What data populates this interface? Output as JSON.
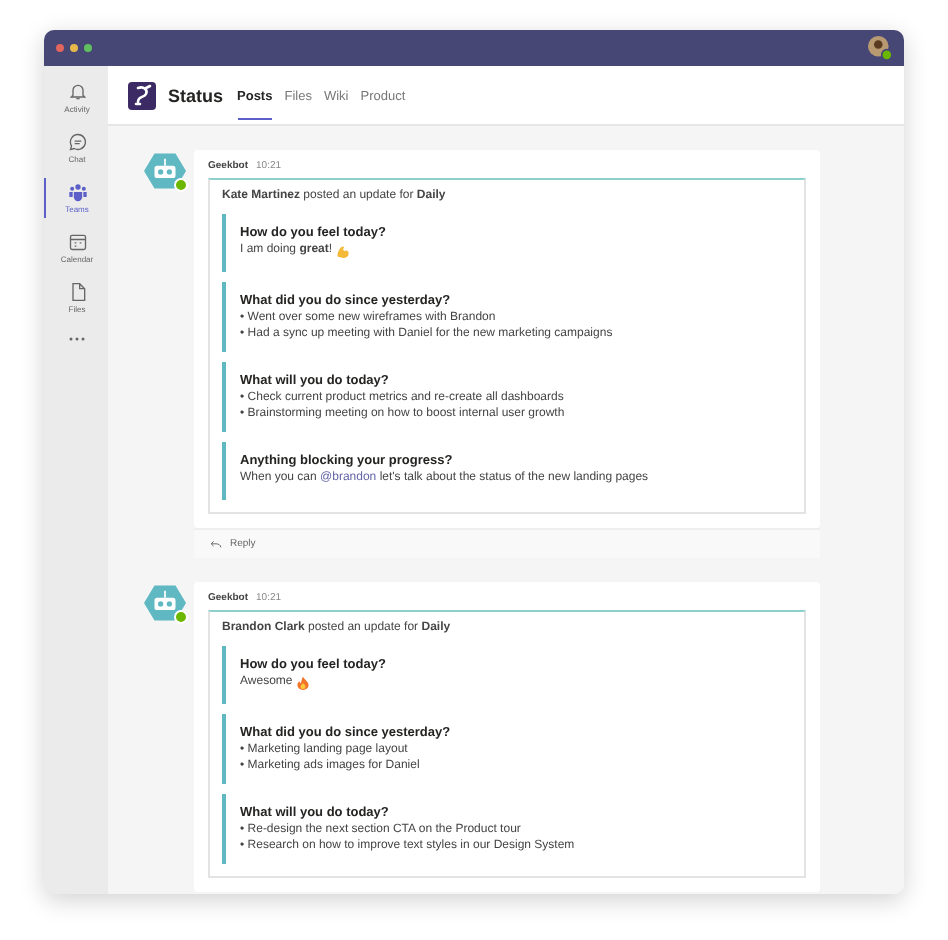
{
  "sidebar": {
    "items": [
      {
        "label": "Activity",
        "selected": false
      },
      {
        "label": "Chat",
        "selected": false
      },
      {
        "label": "Teams",
        "selected": true
      },
      {
        "label": "Calendar",
        "selected": false
      },
      {
        "label": "Files",
        "selected": false
      }
    ]
  },
  "header": {
    "title": "Status",
    "tabs": [
      {
        "label": "Posts",
        "selected": true
      },
      {
        "label": "Files",
        "selected": false
      },
      {
        "label": "Wiki",
        "selected": false
      },
      {
        "label": "Product",
        "selected": false
      }
    ]
  },
  "messages": [
    {
      "author": "Geekbot",
      "time": "10:21",
      "online": true,
      "intro": "**Kate Martinez** posted an update for **Daily**",
      "reply": "Reply",
      "sections": [
        {
          "question": "How do you feel today?",
          "lines": [
            {
              "text": "I am doing **great**!"
            }
          ]
        },
        {
          "question": "What did you do since yesterday?",
          "lines": [
            {
              "text": "• Went over some new wireframes with Brandon"
            },
            {
              "text": "• Had a sync up meeting with Daniel for the new marketing campaigns"
            }
          ]
        },
        {
          "question": "What will you do today?",
          "lines": [
            {
              "text": "• Check current product metrics and re-create all dashboards"
            },
            {
              "text": "• Brainstorming meeting on how to boost internal user growth"
            }
          ]
        },
        {
          "question": "Anything blocking your progress?",
          "lines": [
            {
              "text": "When you can ",
              "mention": "@brandon",
              "after": " let's talk about the status of the new landing pages"
            }
          ]
        }
      ]
    },
    {
      "author": "Geekbot",
      "time": "10:21",
      "online": true,
      "intro": "**Brandon Clark** posted an update for **Daily**",
      "sections": [
        {
          "question": "How do you feel today?",
          "lines": [
            {
              "text": "Awesome"
            }
          ]
        },
        {
          "question": "What did you do since yesterday?",
          "lines": [
            {
              "text": "• Marketing landing page layout"
            },
            {
              "text": "• Marketing ads images for Daniel"
            }
          ]
        },
        {
          "question": "What will you do today?",
          "lines": [
            {
              "text": "• Re-design the next section CTA on the Product tour"
            },
            {
              "text": "• Research on how to improve text styles in our Design System"
            }
          ]
        }
      ]
    }
  ]
}
